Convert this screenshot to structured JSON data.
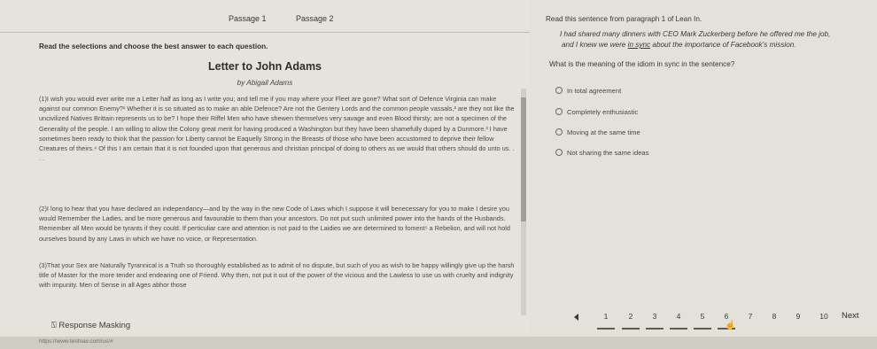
{
  "tabs": [
    {
      "label": "Passage 1"
    },
    {
      "label": "Passage 2"
    }
  ],
  "instructions": "Read the selections and choose the best answer to each question.",
  "passage": {
    "title": "Letter to John Adams",
    "author": "by Abigail Adams",
    "paragraphs": [
      "(1)I wish you would ever write me a Letter half as long as I write you; and tell me if you may where your Fleet are gone? What sort of Defence Virginia can make against our common Enemy?¹ Whether it is so situated as to make an able Defence? Are not the Gentery Lords and the common people vassals,² are they not like the uncivilized Natives Brittain represents us to be? I hope their Riffel Men who have shewen themselves very savage and even Blood thirsty; are not a specimen of the Generality of the people. I am willing to allow the Colony great merit for having produced a Washington but they have been shamefully duped by a Dunmore.³ I have sometimes been ready to think that the passion for Liberty cannot be Eaquelly Strong in the Breasts of those who have been accustomed to deprive their fellow Creatures of theirs.⁴ Of this I am certain that it is not founded upon that generous and christian principal of doing to others as we would that others should do unto us. . . .",
      "(2)I long to hear that you have declared an independancy—and by the way in the new Code of Laws which I suppose it will benecessary for you to make I desire you would Remember the Ladies, and be more generous and favourable to them than your ancestors. Do not put such unlimited power into the hands of the Husbands. Remember all Men would be tyrants if they could. If perticuliar care and attention is not paid to the Laidies we are determined to foment⁵ a Rebelion, and will not hold ourselves bound by any Laws in which we have no voice, or Representation.",
      "(3)That your Sex are Naturally Tyrannical is a Truth so thoroughly established as to admit of no dispute, but such of you as wish to be happy willingly give up the harsh title of Master for the more tender and endearing one of Friend. Why then, not put it out of the power of the vicious and the Lawless to use us with cruelty and indignity with impunity. Men of Sense in all Ages abhor those"
    ]
  },
  "response_masking_label": "Response Masking",
  "status_url": "https://www.testnav.com/us/#",
  "question": {
    "prompt": "Read this sentence from paragraph 1 of Lean In.",
    "quote_line1": "I had shared many dinners with CEO Mark Zuckerberg before he offered me the job,",
    "quote_line2_before": "and I knew we were ",
    "quote_line2_idiom": "in sync",
    "quote_line2_after": " about the importance of Facebook's mission.",
    "text": "What is the meaning of the idiom in sync in the sentence?",
    "options": [
      "In total agreement",
      "Completely enthusiastic",
      "Moving at the same time",
      "Not sharing the same ideas"
    ]
  },
  "pagination": {
    "pages": [
      "1",
      "2",
      "3",
      "4",
      "5",
      "6",
      "7",
      "8",
      "9",
      "10"
    ],
    "current": "6",
    "next_label": "Next"
  }
}
